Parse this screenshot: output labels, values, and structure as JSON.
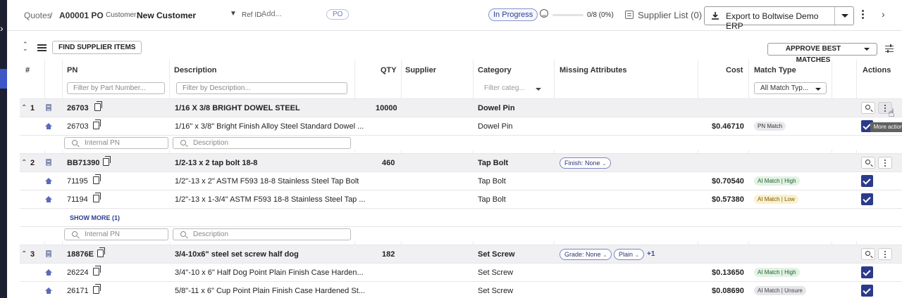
{
  "header": {
    "breadcrumb_root": "Quotes",
    "breadcrumb_sep": "/",
    "quote_id": "A00001 PO",
    "customer_label": "Customer:",
    "customer_value": "New Customer",
    "ref_label": "Ref ID:",
    "ref_placeholder": "Add...",
    "po_badge": "PO",
    "status": "In Progress",
    "progress_text": "0/8 (0%)",
    "progress_fraction": 0,
    "supplier_list": "Supplier List (0)",
    "export_label": "Export to Boltwise Demo ERP"
  },
  "toolbar": {
    "find_label": "FIND SUPPLIER ITEMS",
    "approve_label": "APPROVE BEST MATCHES"
  },
  "table": {
    "headers": {
      "num": "#",
      "pn": "PN",
      "description": "Description",
      "qty": "QTY",
      "supplier": "Supplier",
      "category": "Category",
      "missing": "Missing Attributes",
      "cost": "Cost",
      "match_type": "Match Type",
      "actions": "Actions"
    },
    "filters": {
      "pn_placeholder": "Filter by Part Number...",
      "desc_placeholder": "Filter by Description...",
      "category_placeholder": "Filter categ...",
      "match_value": "All Match Typ..."
    },
    "search": {
      "internal_pn": "Internal PN",
      "description": "Description"
    },
    "groups": [
      {
        "index": "1",
        "pn": "26703",
        "description": "1/16 X 3/8 BRIGHT DOWEL STEEL",
        "qty": "10000",
        "category": "Dowel Pin",
        "children": [
          {
            "pn": "26703",
            "description": "1/16\" x 3/8\" Bright Finish Alloy Steel Standard Dowel ...",
            "category": "Dowel Pin",
            "cost": "$0.46710",
            "match": "PN Match"
          }
        ]
      },
      {
        "index": "2",
        "pn": "BB71390",
        "description": "1/2-13 x 2 tap bolt 18-8",
        "qty": "460",
        "category": "Tap Bolt",
        "missing": [
          "Finish: None"
        ],
        "children": [
          {
            "pn": "71195",
            "description": "1/2\"-13 x 2\" ASTM F593 18-8 Stainless Steel Tap Bolt",
            "category": "Tap Bolt",
            "cost": "$0.70540",
            "match": "AI Match | High"
          },
          {
            "pn": "71194",
            "description": "1/2\"-13 x 1-3/4\" ASTM F593 18-8 Stainless Steel Tap ...",
            "category": "Tap Bolt",
            "cost": "$0.57380",
            "match": "AI Match | Low"
          }
        ],
        "show_more": "SHOW MORE (1)"
      },
      {
        "index": "3",
        "pn": "18876E",
        "description": "3/4-10x6\" steel set screw half dog",
        "qty": "182",
        "category": "Set Screw",
        "missing": [
          "Grade: None",
          "Plain"
        ],
        "missing_more": "+1",
        "children": [
          {
            "pn": "26224",
            "description": "3/4\"-10 x 6\" Half Dog Point Plain Finish Case Harden...",
            "category": "Set Screw",
            "cost": "$0.13650",
            "match": "AI Match | High"
          },
          {
            "pn": "26171",
            "description": "5/8\"-11 x 6\" Cup Point Plain Finish Case Hardened St...",
            "category": "Set Screw",
            "cost": "$0.08690",
            "match": "AI Match | Unsure"
          }
        ]
      }
    ]
  },
  "tooltip": "More actions"
}
